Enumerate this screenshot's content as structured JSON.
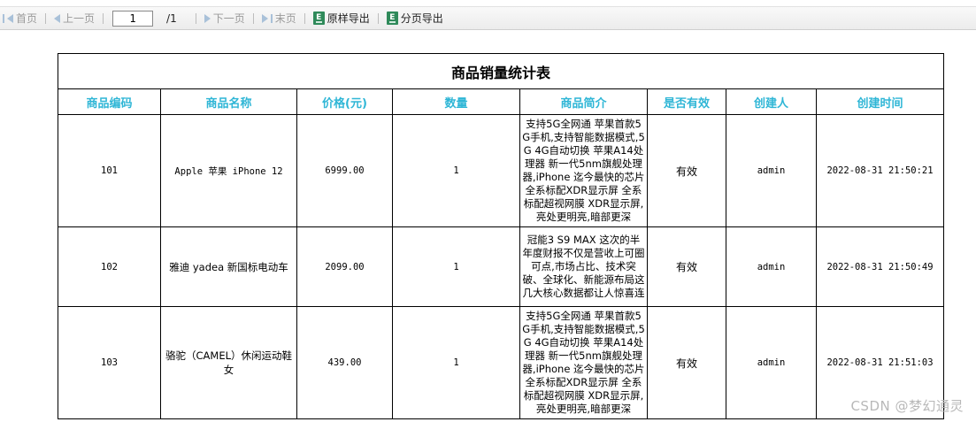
{
  "toolbar": {
    "first": "首页",
    "prev": "上一页",
    "page_current": "1",
    "page_total": "/1",
    "next": "下一页",
    "last": "末页",
    "export_original": "原样导出",
    "export_paged": "分页导出"
  },
  "report": {
    "title": "商品销量统计表",
    "columns": [
      "商品编码",
      "商品名称",
      "价格(元)",
      "数量",
      "商品简介",
      "是否有效",
      "创建人",
      "创建时间"
    ],
    "rows": [
      {
        "code": "101",
        "name": "Apple 苹果 iPhone 12",
        "price": "6999.00",
        "qty": "1",
        "desc": "支持5G全网通 苹果首款5G手机,支持智能数据模式,5G 4G自动切换 苹果A14处理器 新一代5nm旗舰处理器,iPhone 迄今最快的芯片 全系标配XDR显示屏 全系标配超视网膜 XDR显示屏,亮处更明亮,暗部更深",
        "valid": "有效",
        "creator": "admin",
        "created": "2022-08-31 21:50:21"
      },
      {
        "code": "102",
        "name": "雅迪 yadea 新国标电动车",
        "price": "2099.00",
        "qty": "1",
        "desc": "冠能3 S9 MAX 这次的半年度财报不仅是营收上可圈可点,市场占比、技术突破、全球化、新能源布局这几大核心数据都让人惊喜连",
        "valid": "有效",
        "creator": "admin",
        "created": "2022-08-31 21:50:49"
      },
      {
        "code": "103",
        "name": "骆驼（CAMEL）休闲运动鞋女",
        "price": "439.00",
        "qty": "1",
        "desc": "支持5G全网通 苹果首款5G手机,支持智能数据模式,5G 4G自动切换 苹果A14处理器 新一代5nm旗舰处理器,iPhone 迄今最快的芯片 全系标配XDR显示屏 全系标配超视网膜 XDR显示屏,亮处更明亮,暗部更深",
        "valid": "有效",
        "creator": "admin",
        "created": "2022-08-31 21:51:03"
      }
    ]
  },
  "watermark": "CSDN @梦幻通灵"
}
